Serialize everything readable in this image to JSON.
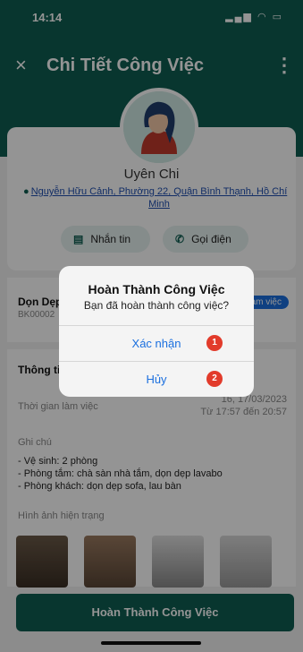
{
  "status_bar": {
    "time": "14:14",
    "icons": "▂▄▆ ◠ ▭"
  },
  "app_bar": {
    "close_icon": "×",
    "title": "Chi Tiết Công Việc",
    "more_icon": "⋮"
  },
  "profile": {
    "name": "Uyên Chi",
    "address": "Nguyễn Hữu Cảnh, Phường 22, Quận Bình Thạnh, Hồ Chí Minh",
    "pin_icon": "●"
  },
  "actions": {
    "message_label": "Nhắn tin",
    "call_label": "Gọi điện",
    "message_icon": "▤",
    "call_icon": "✆"
  },
  "job": {
    "name": "Dọn Dẹp",
    "code": "BK00002",
    "status": "làm việc"
  },
  "info": {
    "section_title": "Thông tin",
    "work_time_label": "Thời gian làm việc",
    "work_date": "16, 17/03/2023",
    "work_time": "Từ 17:57 đến 20:57",
    "notes_label": "Ghi chú",
    "notes": [
      "- Vệ sinh: 2 phòng",
      "- Phòng tắm: chà sàn nhà tắm, dọn dẹp lavabo",
      "- Phòng khách: dọn dẹp sofa, lau bàn"
    ],
    "photos_label": "Hình ảnh hiện trạng"
  },
  "bottom_button": "Hoàn Thành Công Việc",
  "dialog": {
    "title": "Hoàn Thành Công Việc",
    "message": "Bạn đã hoàn thành công việc?",
    "confirm_label": "Xác nhận",
    "cancel_label": "Hủy",
    "badge_1": "1",
    "badge_2": "2"
  }
}
